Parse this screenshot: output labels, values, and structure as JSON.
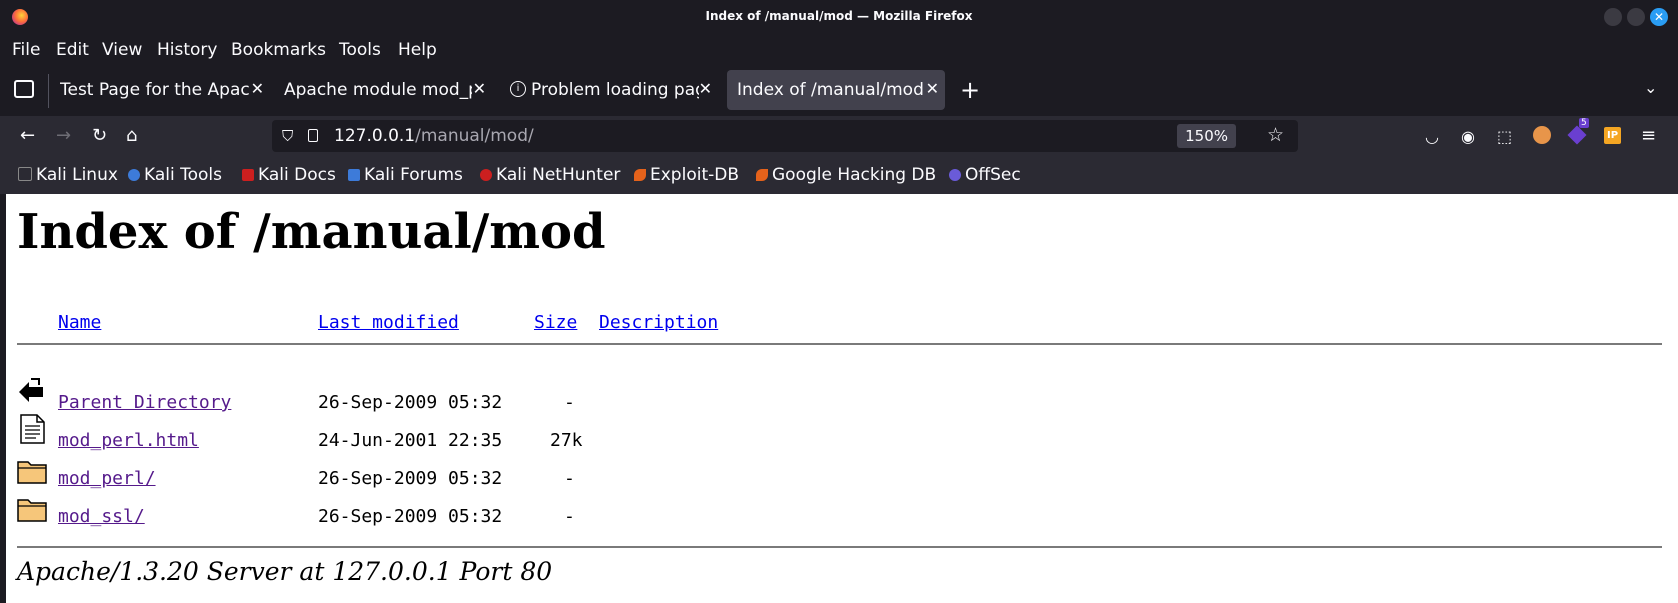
{
  "window": {
    "title": "Index of /manual/mod — Mozilla Firefox"
  },
  "menu": [
    "File",
    "Edit",
    "View",
    "History",
    "Bookmarks",
    "Tools",
    "Help"
  ],
  "tabs": [
    {
      "label": "Test Page for the Apache",
      "active": false
    },
    {
      "label": "Apache module mod_perl",
      "active": false
    },
    {
      "label": "Problem loading page",
      "active": false
    },
    {
      "label": "Index of /manual/mod",
      "active": true
    }
  ],
  "address": {
    "host": "127.0.0.1",
    "path": "/manual/mod/",
    "zoom": "150%"
  },
  "bookmarks": [
    {
      "label": "Kali Linux",
      "color": "#222222"
    },
    {
      "label": "Kali Tools",
      "color": "#3d7bd9"
    },
    {
      "label": "Kali Docs",
      "color": "#cc1f1f"
    },
    {
      "label": "Kali Forums",
      "color": "#3d7bd9"
    },
    {
      "label": "Kali NetHunter",
      "color": "#cc1f1f"
    },
    {
      "label": "Exploit-DB",
      "color": "#e5621b"
    },
    {
      "label": "Google Hacking DB",
      "color": "#e5621b"
    },
    {
      "label": "OffSec",
      "color": "#6a5bd9"
    }
  ],
  "page": {
    "heading": "Index of /manual/mod",
    "columns": {
      "name": "Name",
      "modified": "Last modified",
      "size": "Size",
      "description": "Description"
    },
    "rows": [
      {
        "name": "Parent Directory",
        "modified": "26-Sep-2009 05:32",
        "size": "-",
        "icon": "back-icon"
      },
      {
        "name": "mod_perl.html",
        "modified": "24-Jun-2001 22:35",
        "size": "27k",
        "icon": "file-icon"
      },
      {
        "name": "mod_perl/",
        "modified": "26-Sep-2009 05:32",
        "size": "-",
        "icon": "folder-icon"
      },
      {
        "name": "mod_ssl/",
        "modified": "26-Sep-2009 05:32",
        "size": "-",
        "icon": "folder-icon"
      }
    ],
    "footer": "Apache/1.3.20 Server at 127.0.0.1 Port 80"
  },
  "toolbar": {
    "extension_badge": "5"
  }
}
